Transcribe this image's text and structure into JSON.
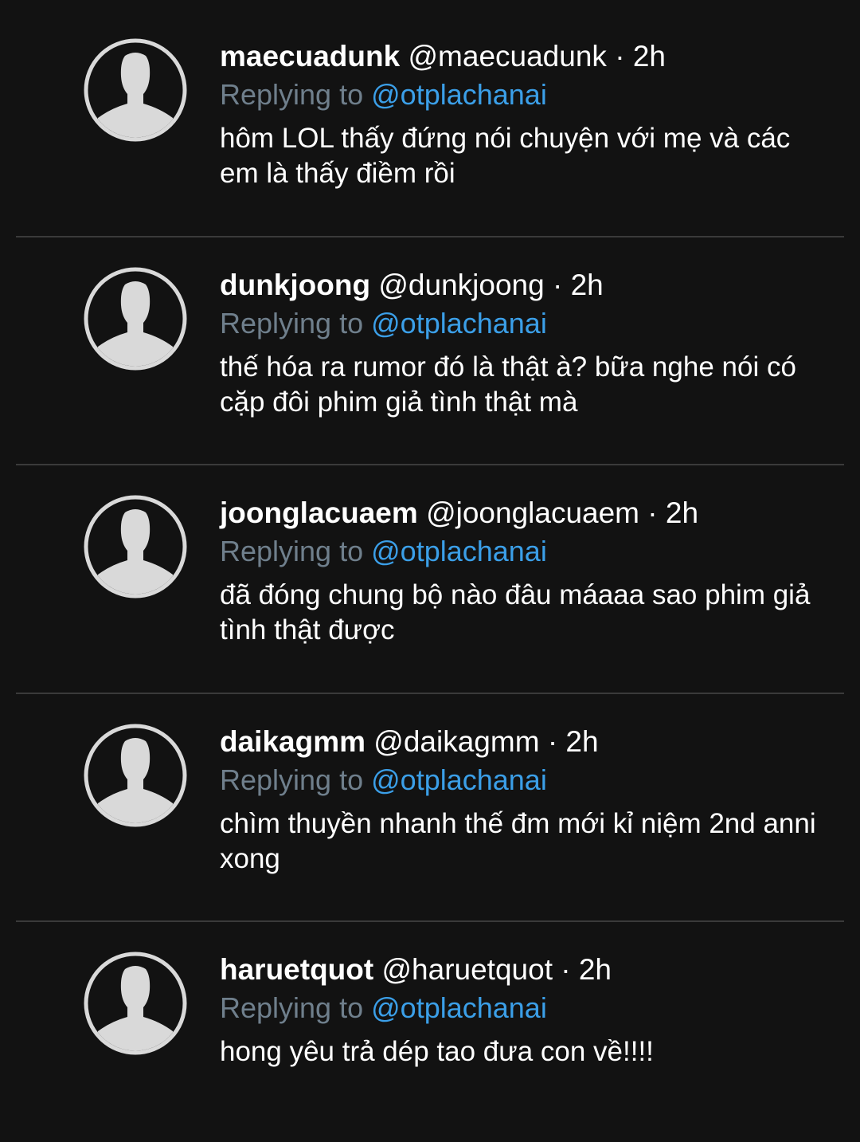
{
  "replying_label": "Replying to",
  "mention": "@otplachanai",
  "tweets": [
    {
      "display_name": "maecuadunk",
      "handle": "@maecuadunk",
      "separator": "·",
      "time": "2h",
      "text": "hôm LOL thấy đứng nói chuyện với mẹ và các em là thấy điềm rồi"
    },
    {
      "display_name": "dunkjoong",
      "handle": "@dunkjoong",
      "separator": "·",
      "time": "2h",
      "text": "thế hóa ra rumor đó là thật à? bữa nghe nói có cặp đôi phim giả tình thật mà"
    },
    {
      "display_name": "joonglacuaem",
      "handle": "@joonglacuaem",
      "separator": "·",
      "time": "2h",
      "text": "đã đóng chung bộ nào đâu máaaa sao phim giả tình thật được"
    },
    {
      "display_name": "daikagmm",
      "handle": "@daikagmm",
      "separator": "·",
      "time": "2h",
      "text": "chìm thuyền nhanh thế đm mới kỉ niệm 2nd anni xong"
    },
    {
      "display_name": "haruetquot",
      "handle": "@haruetquot",
      "separator": "·",
      "time": "2h",
      "text": "hong yêu trả dép tao đưa con về!!!!"
    }
  ],
  "colors": {
    "background": "#121212",
    "text": "#ffffff",
    "muted": "#6f7f8c",
    "link": "#3b9fe8",
    "divider": "#3a3a3a",
    "avatar": "#d9d9d9"
  }
}
